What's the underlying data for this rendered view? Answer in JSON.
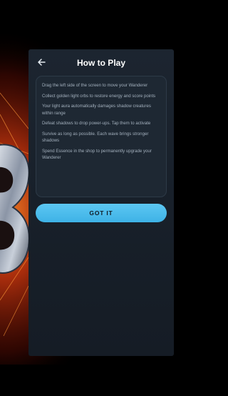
{
  "dialog": {
    "title": "How to Play",
    "back_icon": "arrow-left-icon",
    "instructions": [
      "Drag the left side of the screen to move your Wanderer",
      "Collect golden light orbs to restore energy and score points",
      "Your light aura automatically damages shadow creatures within range",
      "Defeat shadows to drop power-ups. Tap them to activate",
      "Survive as long as possible. Each wave brings stronger shadows",
      "Spend Essence in the shop to permanently upgrade your Wanderer"
    ],
    "confirm_label": "GOT IT"
  },
  "colors": {
    "accent": "#4dbdee",
    "dialog_bg": "#1a222c",
    "text_muted": "#a3b0bd"
  }
}
